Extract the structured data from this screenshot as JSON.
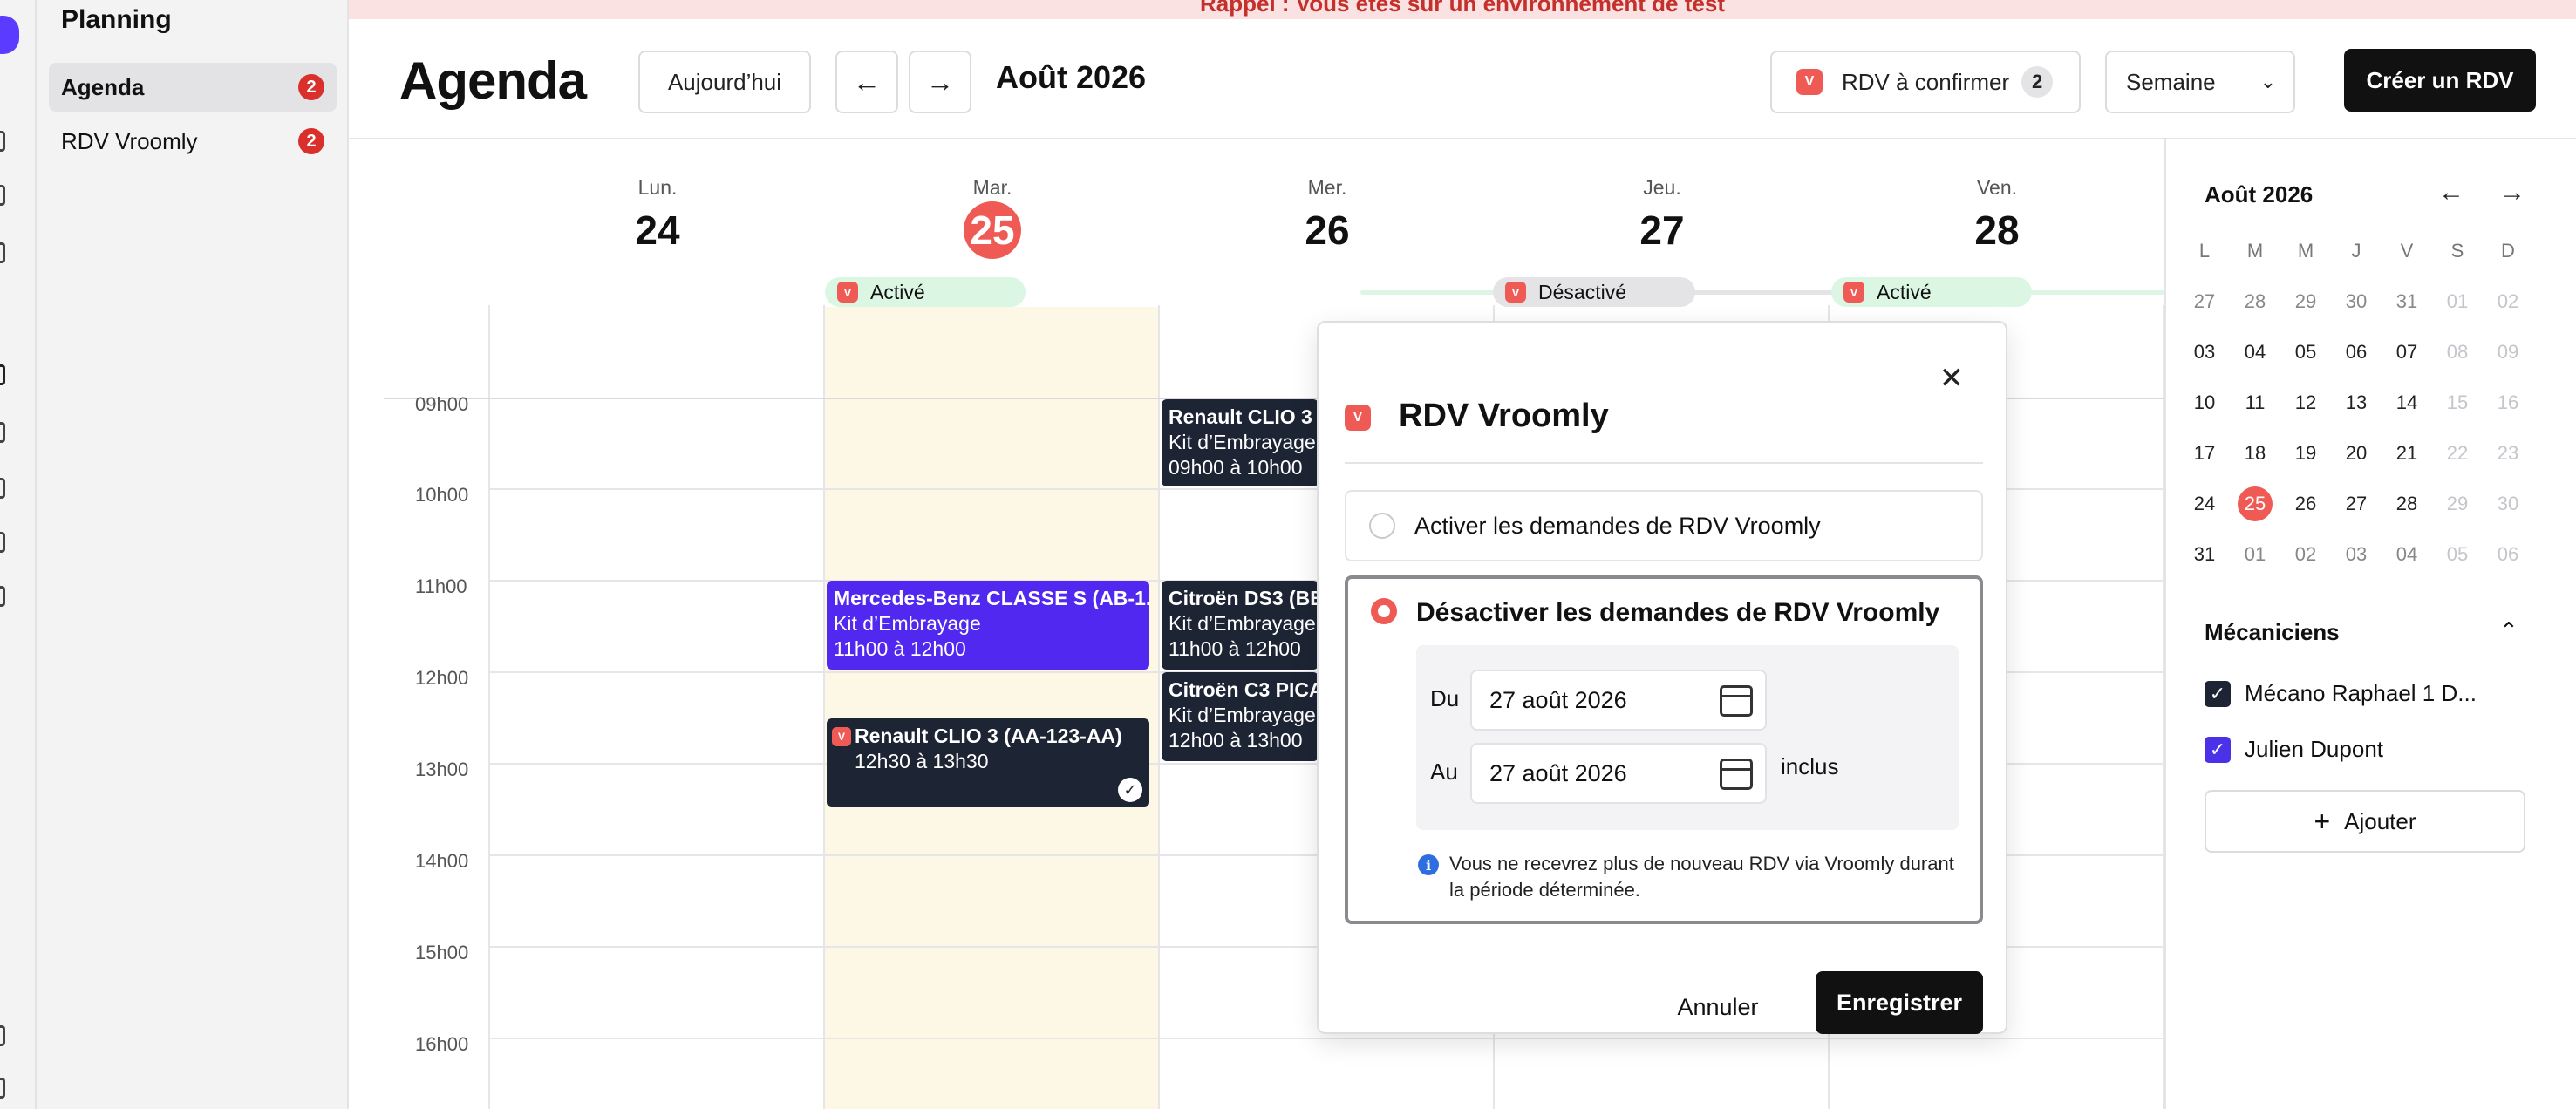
{
  "banner": {
    "text": "Rappel : Vous êtes sur un environnement de test"
  },
  "sidebar": {
    "title": "Planning",
    "items": [
      {
        "label": "Agenda",
        "count": "2"
      },
      {
        "label": "RDV Vroomly",
        "count": "2"
      }
    ]
  },
  "header": {
    "title": "Agenda",
    "today_label": "Aujourd’hui",
    "month": "Août 2026",
    "pending_label": "RDV à confirmer",
    "pending_count": "2",
    "view_select": "Semaine",
    "create_label": "Créer un RDV",
    "badge_letter": "V"
  },
  "calendar": {
    "days": [
      {
        "name": "Lun.",
        "num": "24"
      },
      {
        "name": "Mar.",
        "num": "25"
      },
      {
        "name": "Mer.",
        "num": "26"
      },
      {
        "name": "Jeu.",
        "num": "27"
      },
      {
        "name": "Ven.",
        "num": "28"
      }
    ],
    "statuses": [
      "Activé",
      "Désactivé",
      "Activé"
    ],
    "hours": [
      "09h00",
      "10h00",
      "11h00",
      "12h00",
      "13h00",
      "14h00",
      "15h00",
      "16h00"
    ],
    "events": [
      {
        "title": "Mercedes-Benz CLASSE S (AB-1...",
        "line2": "Kit d’Embrayage",
        "line3": "11h00 à 12h00"
      },
      {
        "title": "Renault CLIO 3 (AA-123-AA)",
        "line2": "12h30 à 13h30"
      },
      {
        "title": "Renault CLIO 3 (A",
        "line2": "Kit d’Embrayage",
        "line3": "09h00 à 10h00"
      },
      {
        "title": "Citroën DS3 (BB-",
        "line2": "Kit d’Embrayage",
        "line3": "11h00 à 12h00"
      },
      {
        "title": "Citroën C3 PICAS",
        "line2": "Kit d’Embrayage",
        "line3": "12h00 à 13h00"
      }
    ],
    "colors": {
      "accent": "#ef5a55",
      "event_dark": "#1d2434",
      "event_purple": "#5028f0",
      "today_bg": "#fdf8e6",
      "active_green": "#dcf6e4",
      "disabled_gray": "#e4e4e7"
    }
  },
  "mini_calendar": {
    "month": "Août 2026",
    "weekdays": [
      "L",
      "M",
      "M",
      "J",
      "V",
      "S",
      "D"
    ],
    "weeks": [
      [
        "27",
        "28",
        "29",
        "30",
        "31",
        "01",
        "02"
      ],
      [
        "03",
        "04",
        "05",
        "06",
        "07",
        "08",
        "09"
      ],
      [
        "10",
        "11",
        "12",
        "13",
        "14",
        "15",
        "16"
      ],
      [
        "17",
        "18",
        "19",
        "20",
        "21",
        "22",
        "23"
      ],
      [
        "24",
        "25",
        "26",
        "27",
        "28",
        "29",
        "30"
      ],
      [
        "31",
        "01",
        "02",
        "03",
        "04",
        "05",
        "06"
      ]
    ],
    "selected": "25"
  },
  "mechanics": {
    "title": "Mécaniciens",
    "items": [
      "Mécano Raphael 1 D...",
      "Julien Dupont"
    ],
    "add_label": "Ajouter"
  },
  "modal": {
    "title": "RDV Vroomly",
    "option_activate": "Activer les demandes de RDV Vroomly",
    "option_deactivate": "Désactiver les demandes de RDV Vroomly",
    "from_label": "Du",
    "from_value": "27 août 2026",
    "to_label": "Au",
    "to_value": "27 août 2026",
    "inclusive": "inclus",
    "info": "Vous ne recevrez plus de nouveau RDV via Vroomly durant la période déterminée.",
    "cancel": "Annuler",
    "save": "Enregistrer"
  }
}
